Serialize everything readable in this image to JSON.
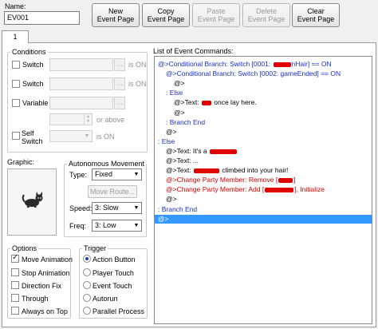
{
  "name": {
    "label": "Name:",
    "value": "EV001"
  },
  "toolbar": {
    "new_page": "New\nEvent Page",
    "copy_page": "Copy\nEvent Page",
    "paste_page": "Paste\nEvent Page",
    "delete_page": "Delete\nEvent Page",
    "clear_page": "Clear\nEvent Page"
  },
  "tab": {
    "label": "1"
  },
  "conditions": {
    "title": "Conditions",
    "switch1": "Switch",
    "switch2": "Switch",
    "is_on1": "is ON",
    "is_on2": "is ON",
    "variable": "Variable",
    "or_above": "or above",
    "self_switch": "Self\nSwitch",
    "is_on3": "is ON"
  },
  "graphic": {
    "title": "Graphic:"
  },
  "autonomous": {
    "title": "Autonomous Movement",
    "type_label": "Type:",
    "type_value": "Fixed",
    "move_route": "Move Route...",
    "speed_label": "Speed:",
    "speed_value": "3: Slow",
    "freq_label": "Freq:",
    "freq_value": "3: Low"
  },
  "options": {
    "title": "Options",
    "move_animation": "Move Animation",
    "stop_animation": "Stop Animation",
    "direction_fix": "Direction Fix",
    "through": "Through",
    "always_on_top": "Always on Top"
  },
  "trigger": {
    "title": "Trigger",
    "action_button": "Action Button",
    "player_touch": "Player Touch",
    "event_touch": "Event Touch",
    "autorun": "Autorun",
    "parallel_process": "Parallel Process"
  },
  "commands": {
    "title": "List of Event Commands:",
    "lines": [
      {
        "text": "@>Conditional Branch: Switch [0001: ",
        "tail": "nHair] == ON",
        "color": "blue",
        "indent": 0,
        "redact": true
      },
      {
        "text": "@>Conditional Branch: Switch [0002: gameEnded] == ON",
        "tail": "",
        "color": "blue",
        "indent": 1,
        "redact": false
      },
      {
        "text": "@>",
        "tail": "",
        "color": "black",
        "indent": 2,
        "redact": false
      },
      {
        "text": ": Else",
        "tail": "",
        "color": "blue",
        "indent": 1,
        "redact": false
      },
      {
        "text": "@>Text: ",
        "tail": " once lay here.",
        "color": "black",
        "indent": 2,
        "redact": true
      },
      {
        "text": "@>",
        "tail": "",
        "color": "black",
        "indent": 2,
        "redact": false
      },
      {
        "text": ": Branch End",
        "tail": "",
        "color": "blue",
        "indent": 1,
        "redact": false
      },
      {
        "text": "@>",
        "tail": "",
        "color": "black",
        "indent": 1,
        "redact": false
      },
      {
        "text": ": Else",
        "tail": "",
        "color": "blue",
        "indent": 0,
        "redact": false
      },
      {
        "text": "@>Text: It's a ",
        "tail": "",
        "color": "black",
        "indent": 1,
        "redact": true
      },
      {
        "text": "@>Text: ...",
        "tail": "",
        "color": "black",
        "indent": 1,
        "redact": false
      },
      {
        "text": "@>Text: ",
        "tail": " climbed into your hair!",
        "color": "black",
        "indent": 1,
        "redact": true
      },
      {
        "text": "@>Change Party Member: Remove [",
        "tail": "]",
        "color": "red",
        "indent": 1,
        "redact": true
      },
      {
        "text": "@>Change Party Member: Add [",
        "tail": "], Initialize",
        "color": "red",
        "indent": 1,
        "redact": true
      },
      {
        "text": "@>",
        "tail": "",
        "color": "black",
        "indent": 1,
        "redact": false
      },
      {
        "text": ": Branch End",
        "tail": "",
        "color": "blue",
        "indent": 0,
        "redact": false
      },
      {
        "text": "@>",
        "tail": "",
        "color": "black",
        "indent": 0,
        "redact": false,
        "selected": true
      }
    ]
  },
  "colors": {
    "selected_row": "#3399ff",
    "conditional": "#1a2fd0",
    "party_change": "#d40000"
  }
}
